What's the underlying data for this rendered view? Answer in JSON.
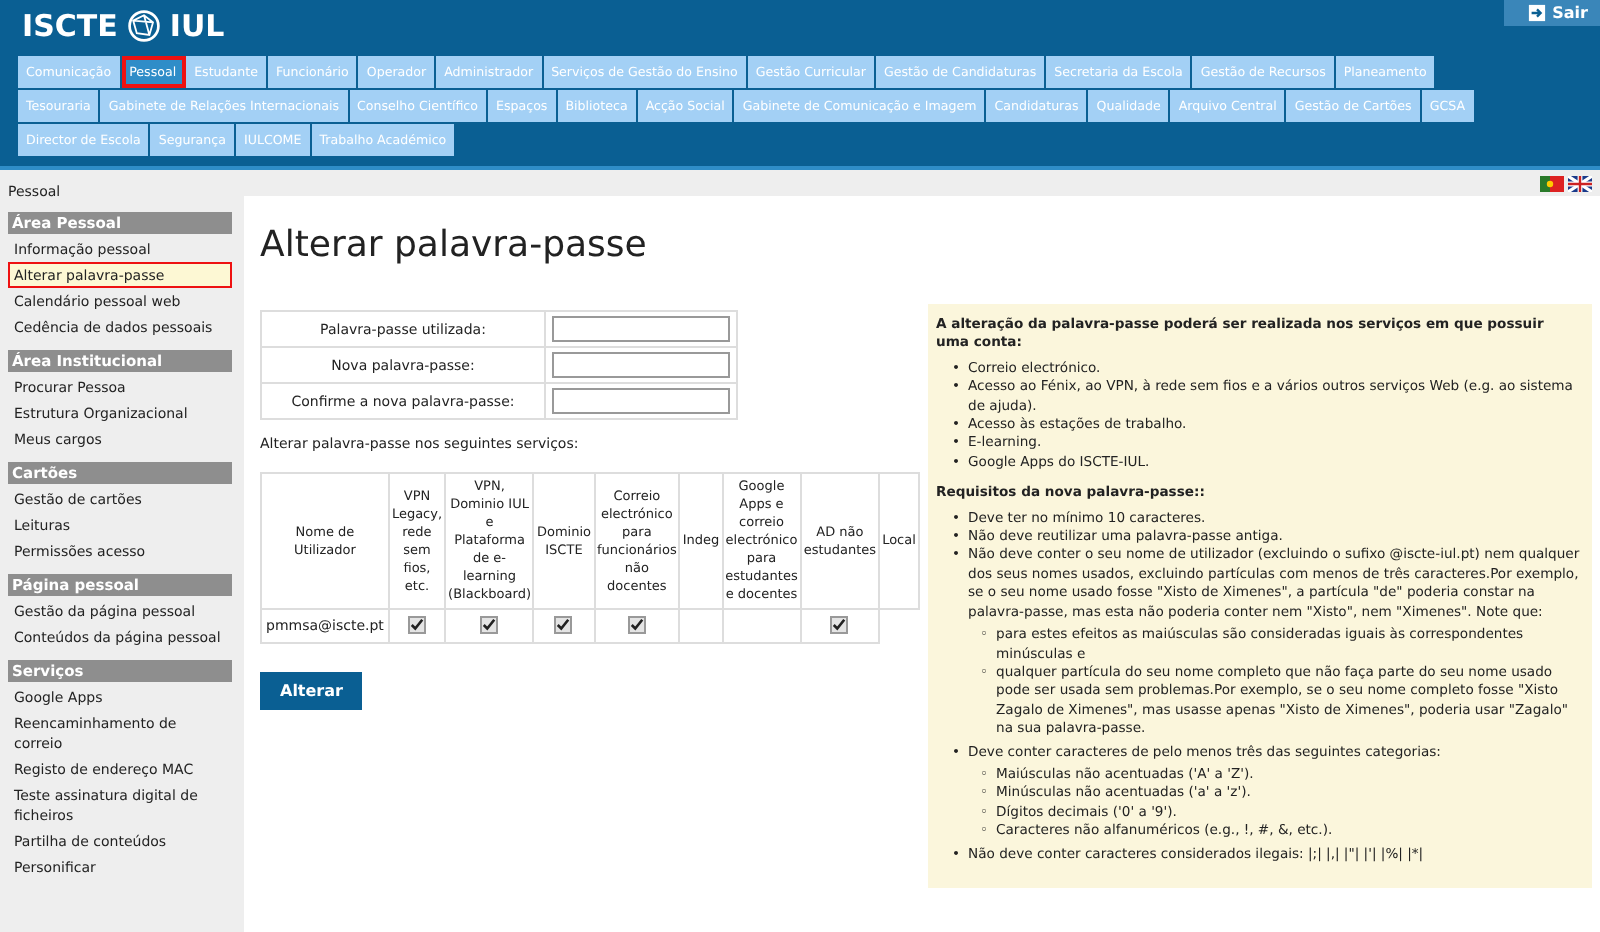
{
  "header": {
    "logo_left": "ISCTE",
    "logo_right": "IUL",
    "logout": "Sair"
  },
  "tabs": [
    {
      "label": "Comunicação",
      "selected": false
    },
    {
      "label": "Pessoal",
      "selected": true
    },
    {
      "label": "Estudante",
      "selected": false
    },
    {
      "label": "Funcionário",
      "selected": false
    },
    {
      "label": "Operador",
      "selected": false
    },
    {
      "label": "Administrador",
      "selected": false
    },
    {
      "label": "Serviços de Gestão do Ensino",
      "selected": false
    },
    {
      "label": "Gestão Curricular",
      "selected": false
    },
    {
      "label": "Gestão de Candidaturas",
      "selected": false
    },
    {
      "label": "Secretaria da Escola",
      "selected": false
    },
    {
      "label": "Gestão de Recursos",
      "selected": false
    },
    {
      "label": "Planeamento",
      "selected": false
    },
    {
      "label": "Tesouraria",
      "selected": false
    },
    {
      "label": "Gabinete de Relações Internacionais",
      "selected": false
    },
    {
      "label": "Conselho Científico",
      "selected": false
    },
    {
      "label": "Espaços",
      "selected": false
    },
    {
      "label": "Biblioteca",
      "selected": false
    },
    {
      "label": "Acção Social",
      "selected": false
    },
    {
      "label": "Gabinete de Comunicação e Imagem",
      "selected": false
    },
    {
      "label": "Candidaturas",
      "selected": false
    },
    {
      "label": "Qualidade",
      "selected": false
    },
    {
      "label": "Arquivo Central",
      "selected": false
    },
    {
      "label": "Gestão de Cartões",
      "selected": false
    },
    {
      "label": "GCSA",
      "selected": false
    },
    {
      "label": "Director de Escola",
      "selected": false
    },
    {
      "label": "Segurança",
      "selected": false
    },
    {
      "label": "IULCOME",
      "selected": false
    },
    {
      "label": "Trabalho Académico",
      "selected": false
    }
  ],
  "sidebar": {
    "breadcrumb": "Pessoal",
    "sections": [
      {
        "title": "Área Pessoal",
        "items": [
          {
            "label": "Informação pessoal",
            "selected": false
          },
          {
            "label": "Alterar palavra-passe",
            "selected": true
          },
          {
            "label": "Calendário pessoal web",
            "selected": false
          },
          {
            "label": "Cedência de dados pessoais",
            "selected": false
          }
        ]
      },
      {
        "title": "Área Institucional",
        "items": [
          {
            "label": "Procurar Pessoa",
            "selected": false
          },
          {
            "label": "Estrutura Organizacional",
            "selected": false
          },
          {
            "label": "Meus cargos",
            "selected": false
          }
        ]
      },
      {
        "title": "Cartões",
        "items": [
          {
            "label": "Gestão de cartões",
            "selected": false
          },
          {
            "label": "Leituras",
            "selected": false
          },
          {
            "label": "Permissões acesso",
            "selected": false
          }
        ]
      },
      {
        "title": "Página pessoal",
        "items": [
          {
            "label": "Gestão da página pessoal",
            "selected": false
          },
          {
            "label": "Conteúdos da página pessoal",
            "selected": false
          }
        ]
      },
      {
        "title": "Serviços",
        "items": [
          {
            "label": "Google Apps",
            "selected": false
          },
          {
            "label": "Reencaminhamento de correio",
            "selected": false
          },
          {
            "label": "Registo de endereço MAC",
            "selected": false
          },
          {
            "label": "Teste assinatura digital de ficheiros",
            "selected": false
          },
          {
            "label": "Partilha de conteúdos",
            "selected": false
          },
          {
            "label": "Personificar",
            "selected": false
          }
        ]
      }
    ]
  },
  "page": {
    "title": "Alterar palavra-passe",
    "fields": [
      {
        "label": "Palavra-passe utilizada:"
      },
      {
        "label": "Nova palavra-passe:"
      },
      {
        "label": "Confirme a nova palavra-passe:"
      }
    ],
    "services_caption": "Alterar palavra-passe nos seguintes serviços:",
    "table": {
      "columns": [
        "Nome de Utilizador",
        "VPN Legacy, rede sem fios, etc.",
        "VPN, Dominio IUL e Plataforma de e-learning (Blackboard)",
        "Dominio ISCTE",
        "Correio electrónico para funcionários não docentes",
        "Indeg",
        "Google Apps e correio electrónico para estudantes e docentes",
        "AD não estudantes",
        "Local"
      ],
      "rows": [
        {
          "user": "pmmsa@iscte.pt",
          "cells": [
            {
              "kind": "checkbox",
              "checked": true
            },
            {
              "kind": "checkbox",
              "checked": true
            },
            {
              "kind": "checkbox",
              "checked": true
            },
            {
              "kind": "checkbox",
              "checked": true
            },
            {
              "kind": "empty"
            },
            {
              "kind": "empty"
            },
            {
              "kind": "checkbox",
              "checked": true
            }
          ]
        }
      ]
    },
    "submit": "Alterar"
  },
  "info": {
    "sections": [
      {
        "heading": "A alteração da palavra-passe poderá ser realizada nos serviços em que possuir uma conta:",
        "items": [
          {
            "marker": "•",
            "text": "Correio electrónico."
          },
          {
            "marker": "•",
            "text": "Acesso ao Fénix, ao VPN, à rede sem fios e a vários outros serviços Web (e.g. ao sistema de ajuda)."
          },
          {
            "marker": "•",
            "text": "Acesso às estações de trabalho."
          },
          {
            "marker": "•",
            "text": "E-learning."
          },
          {
            "marker": "•",
            "text": "Google Apps do ISCTE-IUL."
          }
        ]
      },
      {
        "heading": "Requisitos da nova palavra-passe::",
        "items": [
          {
            "marker": "•",
            "text": "Deve ter no mínimo 10 caracteres."
          },
          {
            "marker": "•",
            "text": "Não deve reutilizar uma palavra-passe antiga."
          },
          {
            "marker": "•",
            "text": "Não deve conter o seu nome de utilizador (excluindo o sufixo @iscte-iul.pt) nem qualquer dos seus nomes usados, excluindo partículas com menos de três caracteres.Por exemplo, se o seu nome usado fosse \"Xisto de Ximenes\", a partícula \"de\" poderia constar na palavra-passe, mas esta não poderia conter nem \"Xisto\", nem \"Ximenes\". Note que:",
            "children": [
              {
                "marker": "◦",
                "text": "para estes efeitos as maiúsculas são consideradas iguais às correspondentes minúsculas e"
              },
              {
                "marker": "◦",
                "text": "qualquer partícula do seu nome completo que não faça parte do seu nome usado pode ser usada sem problemas.Por exemplo, se o seu nome completo fosse \"Xisto Zagalo de Ximenes\", mas usasse apenas \"Xisto de Ximenes\", poderia usar \"Zagalo\" na sua palavra-passe."
              }
            ]
          },
          {
            "marker": "•",
            "text": "Deve conter caracteres de pelo menos três das seguintes categorias:",
            "children": [
              {
                "marker": "◦",
                "text": "Maiúsculas não acentuadas ('A' a 'Z')."
              },
              {
                "marker": "◦",
                "text": "Minúsculas não acentuadas ('a' a 'z')."
              },
              {
                "marker": "◦",
                "text": "Dígitos decimais ('0' a '9')."
              },
              {
                "marker": "◦",
                "text": "Caracteres não alfanuméricos (e.g., !, #, &, etc.)."
              }
            ]
          },
          {
            "marker": "•",
            "text": "Não deve conter caracteres considerados ilegais: |;| |,| |\"| |'| |%| |*|"
          }
        ]
      }
    ]
  }
}
